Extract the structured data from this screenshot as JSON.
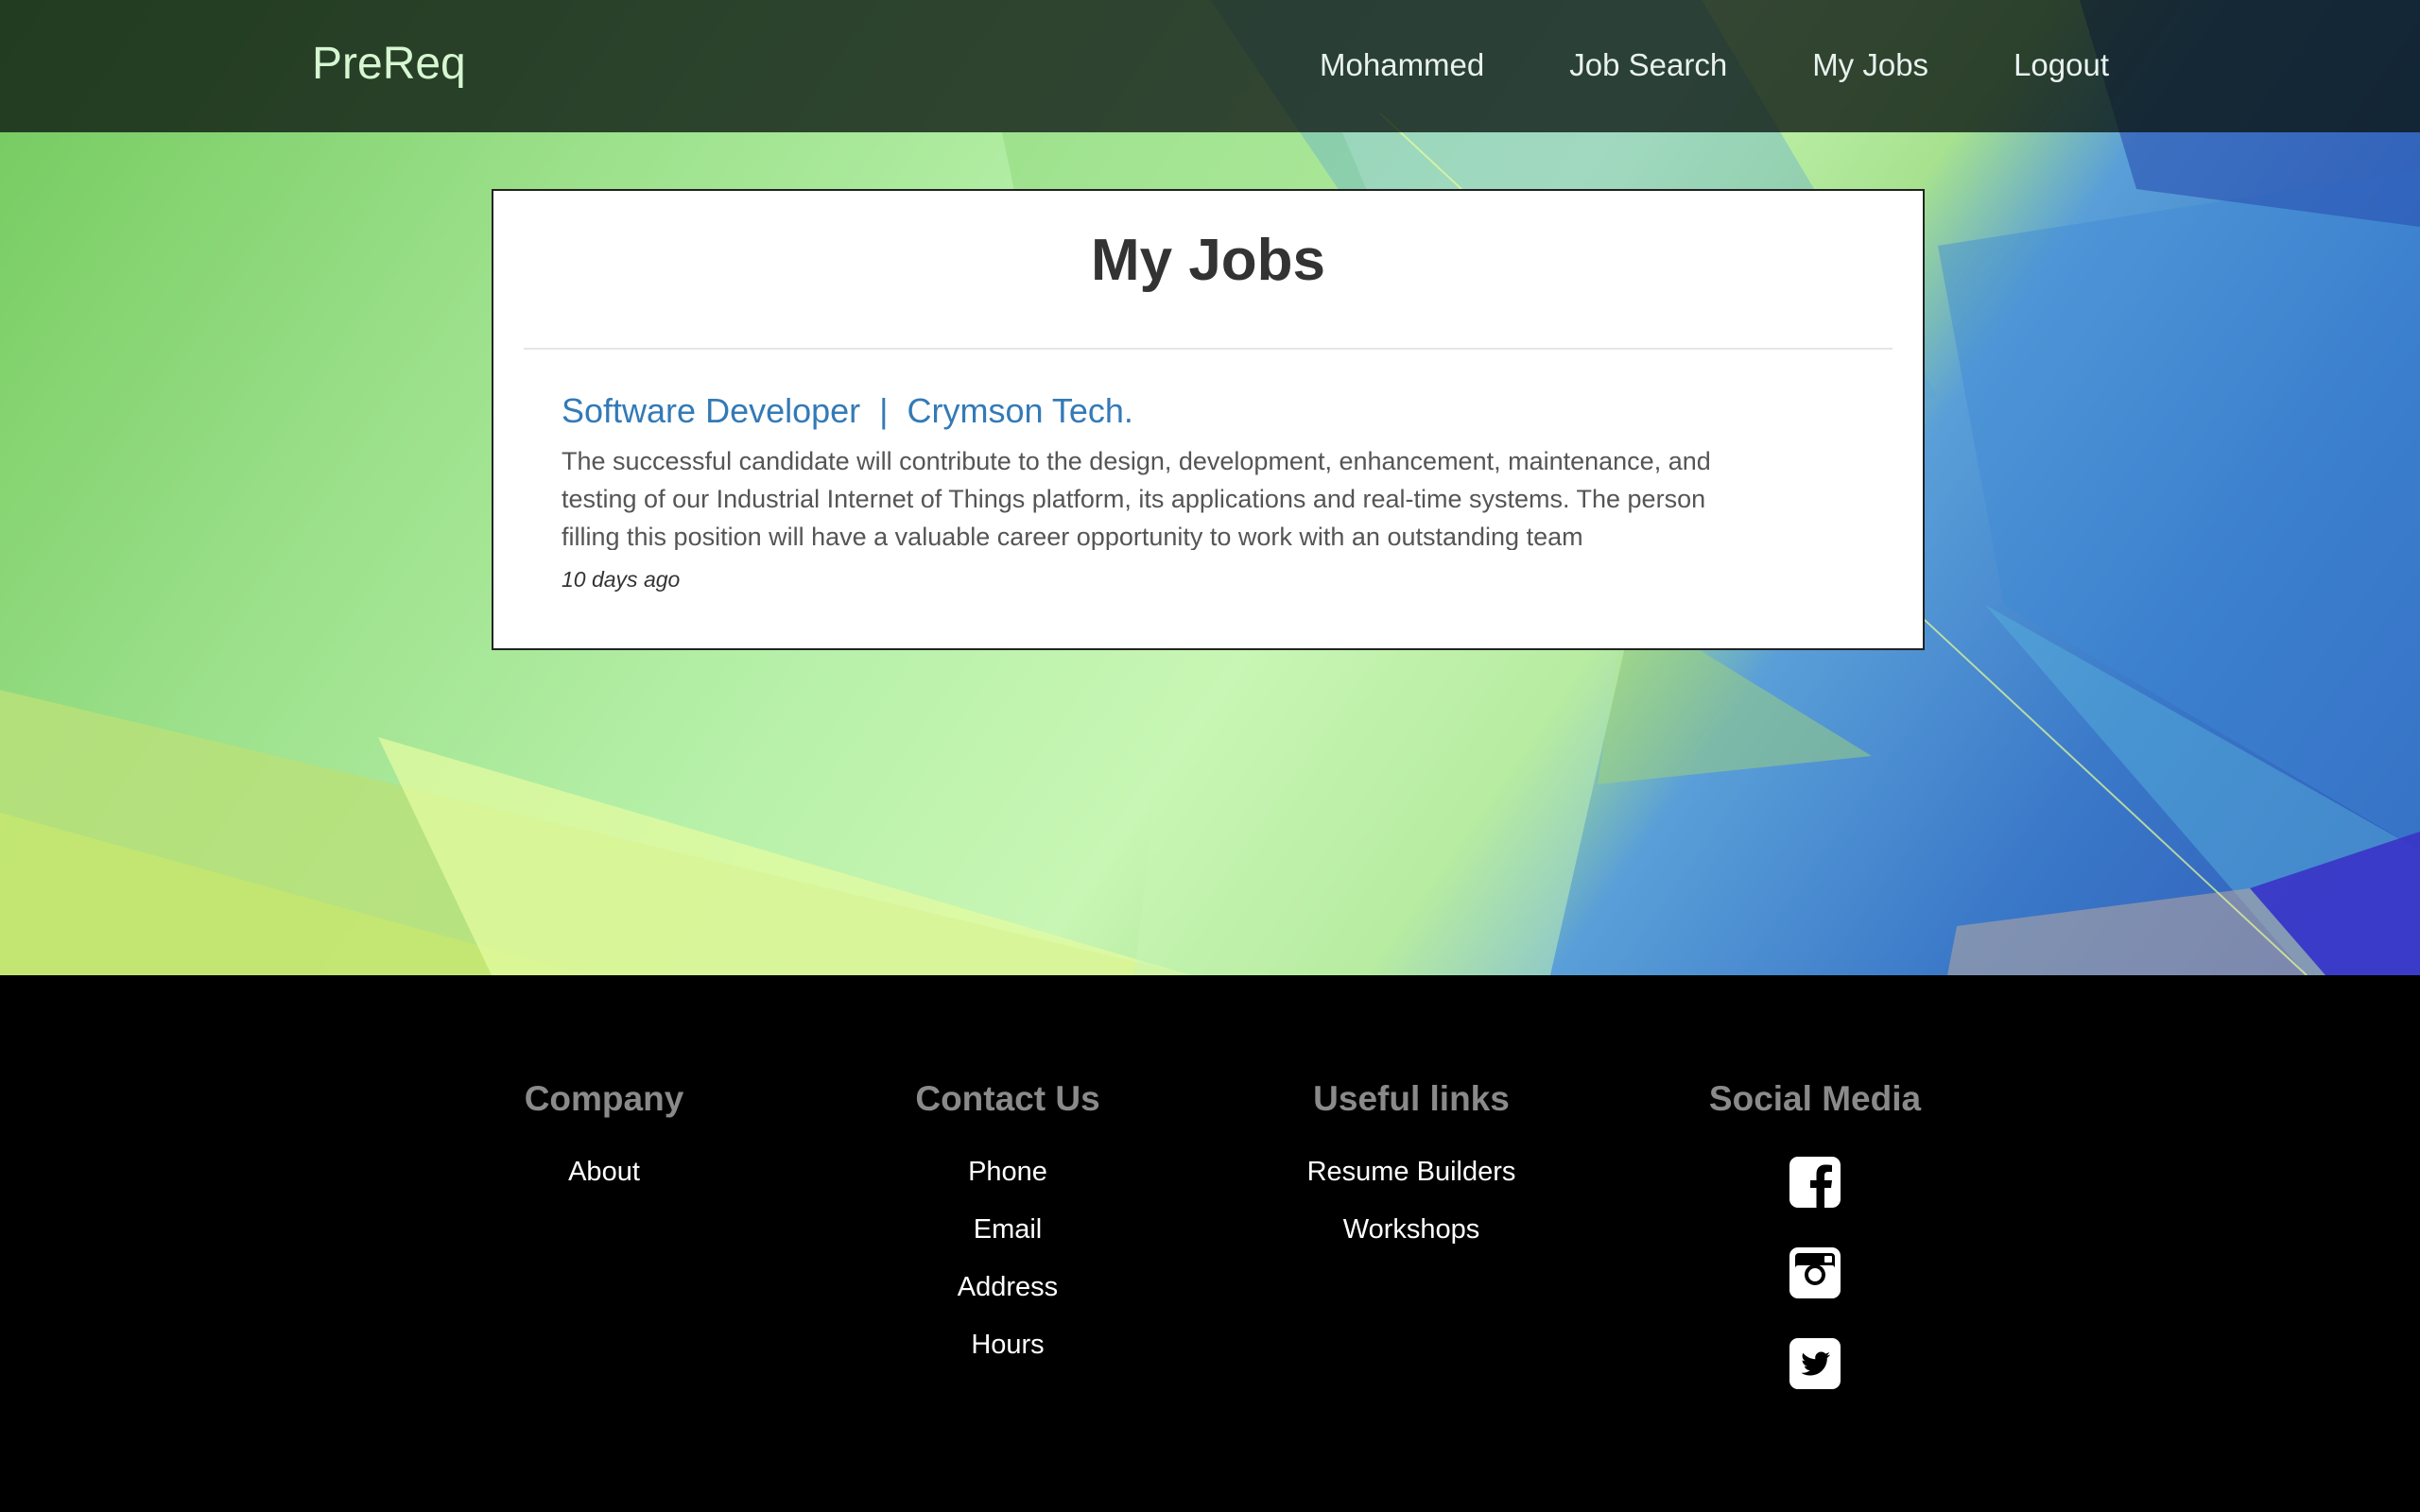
{
  "navbar": {
    "brand": "PreReq",
    "links": [
      "Mohammed",
      "Job Search",
      "My Jobs",
      "Logout"
    ]
  },
  "card": {
    "title": "My Jobs",
    "jobs": [
      {
        "title": "Software Developer  |  Crymson Tech.",
        "description": "The successful candidate will contribute to the design, development, enhancement, maintenance, and testing of our Industrial Internet of Things platform, its applications and real-time systems. The person filling this position will have a valuable career opportunity to work with an outstanding team",
        "age": "10 days ago"
      }
    ]
  },
  "footer": {
    "columns": [
      {
        "heading": "Company",
        "links": [
          "About"
        ]
      },
      {
        "heading": "Contact Us",
        "links": [
          "Phone",
          "Email",
          "Address",
          "Hours"
        ]
      },
      {
        "heading": "Useful links",
        "links": [
          "Resume Builders",
          "Workshops"
        ]
      },
      {
        "heading": "Social Media",
        "icons": [
          "facebook-icon",
          "instagram-icon",
          "twitter-icon"
        ]
      }
    ]
  },
  "colors": {
    "link_blue": "#337ab7",
    "footer_heading": "#8a8a8a",
    "brand": "#d6f7d2"
  }
}
